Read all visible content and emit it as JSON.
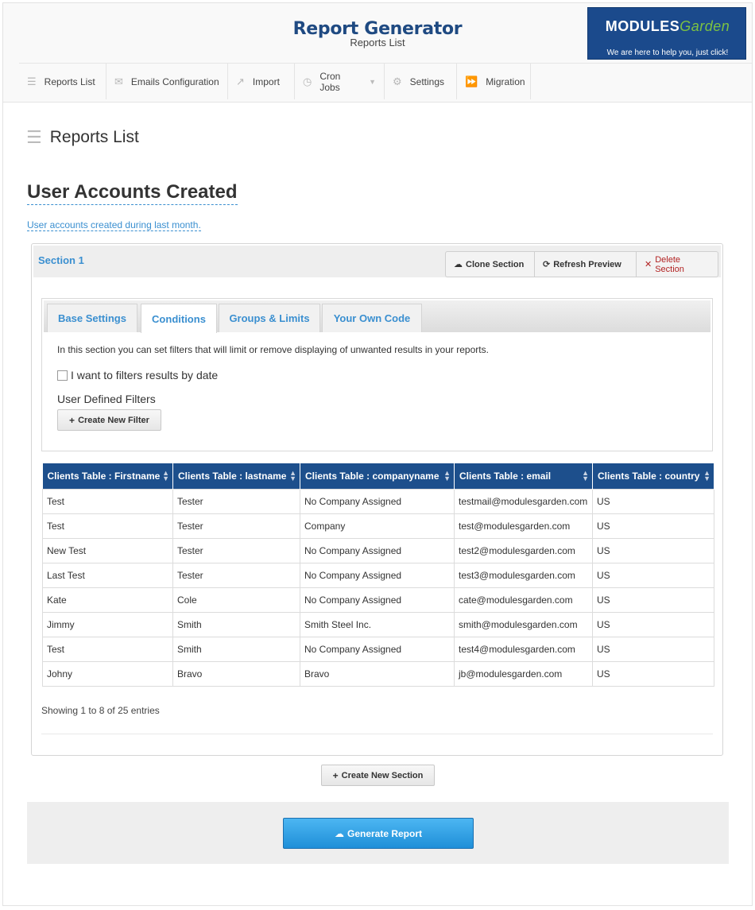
{
  "header": {
    "title": "Report Generator",
    "subtitle": "Reports List",
    "brand": {
      "logo_main": "MODULES",
      "logo_accent": "Garden",
      "tagline": "We are here to help you, just click!"
    }
  },
  "nav": [
    {
      "label": "Reports List",
      "icon": "list-icon"
    },
    {
      "label": "Emails Configuration",
      "icon": "envelope-icon"
    },
    {
      "label": "Import",
      "icon": "share-icon"
    },
    {
      "label": "Cron Jobs",
      "icon": "clock-icon"
    },
    {
      "label": "Settings",
      "icon": "gears-icon"
    },
    {
      "label": "Migration",
      "icon": "forward-icon"
    }
  ],
  "page": {
    "title": "Reports List",
    "report_name": "User Accounts Created",
    "report_description": "User accounts created during last month."
  },
  "section": {
    "label": "Section 1",
    "buttons": {
      "clone": "Clone Section",
      "refresh": "Refresh Preview",
      "delete": "Delete Section"
    },
    "tabs": [
      "Base Settings",
      "Conditions",
      "Groups & Limits",
      "Your Own Code"
    ],
    "active_tab": "Conditions",
    "description": "In this section you can set filters that will limit or remove displaying of unwanted results in your reports.",
    "date_filter_label": "I want to filters results by date",
    "date_filter_checked": false,
    "user_filters_label": "User Defined Filters",
    "create_filter_label": "Create New Filter"
  },
  "table": {
    "columns": [
      "Clients Table : Firstname",
      "Clients Table : lastname",
      "Clients Table : companyname",
      "Clients Table : email",
      "Clients Table : country"
    ],
    "rows": [
      [
        "Test",
        "Tester",
        "No Company Assigned",
        "testmail@modulesgarden.com",
        "US"
      ],
      [
        "Test",
        "Tester",
        "Company",
        "test@modulesgarden.com",
        "US"
      ],
      [
        "New Test",
        "Tester",
        "No Company Assigned",
        "test2@modulesgarden.com",
        "US"
      ],
      [
        "Last Test",
        "Tester",
        "No Company Assigned",
        "test3@modulesgarden.com",
        "US"
      ],
      [
        "Kate",
        "Cole",
        "No Company Assigned",
        "cate@modulesgarden.com",
        "US"
      ],
      [
        "Jimmy",
        "Smith",
        "Smith Steel Inc.",
        "smith@modulesgarden.com",
        "US"
      ],
      [
        "Test",
        "Smith",
        "No Company Assigned",
        "test4@modulesgarden.com",
        "US"
      ],
      [
        "Johny",
        "Bravo",
        "Bravo",
        "jb@modulesgarden.com",
        "US"
      ]
    ],
    "info": "Showing 1 to 8 of 25 entries"
  },
  "actions": {
    "create_section": "Create New Section",
    "generate_report": "Generate Report"
  },
  "colors": {
    "header_blue": "#1f4a82",
    "table_head": "#1d4f8c",
    "link_blue": "#3a8fd0",
    "primary_button": "#1f8fd8"
  }
}
